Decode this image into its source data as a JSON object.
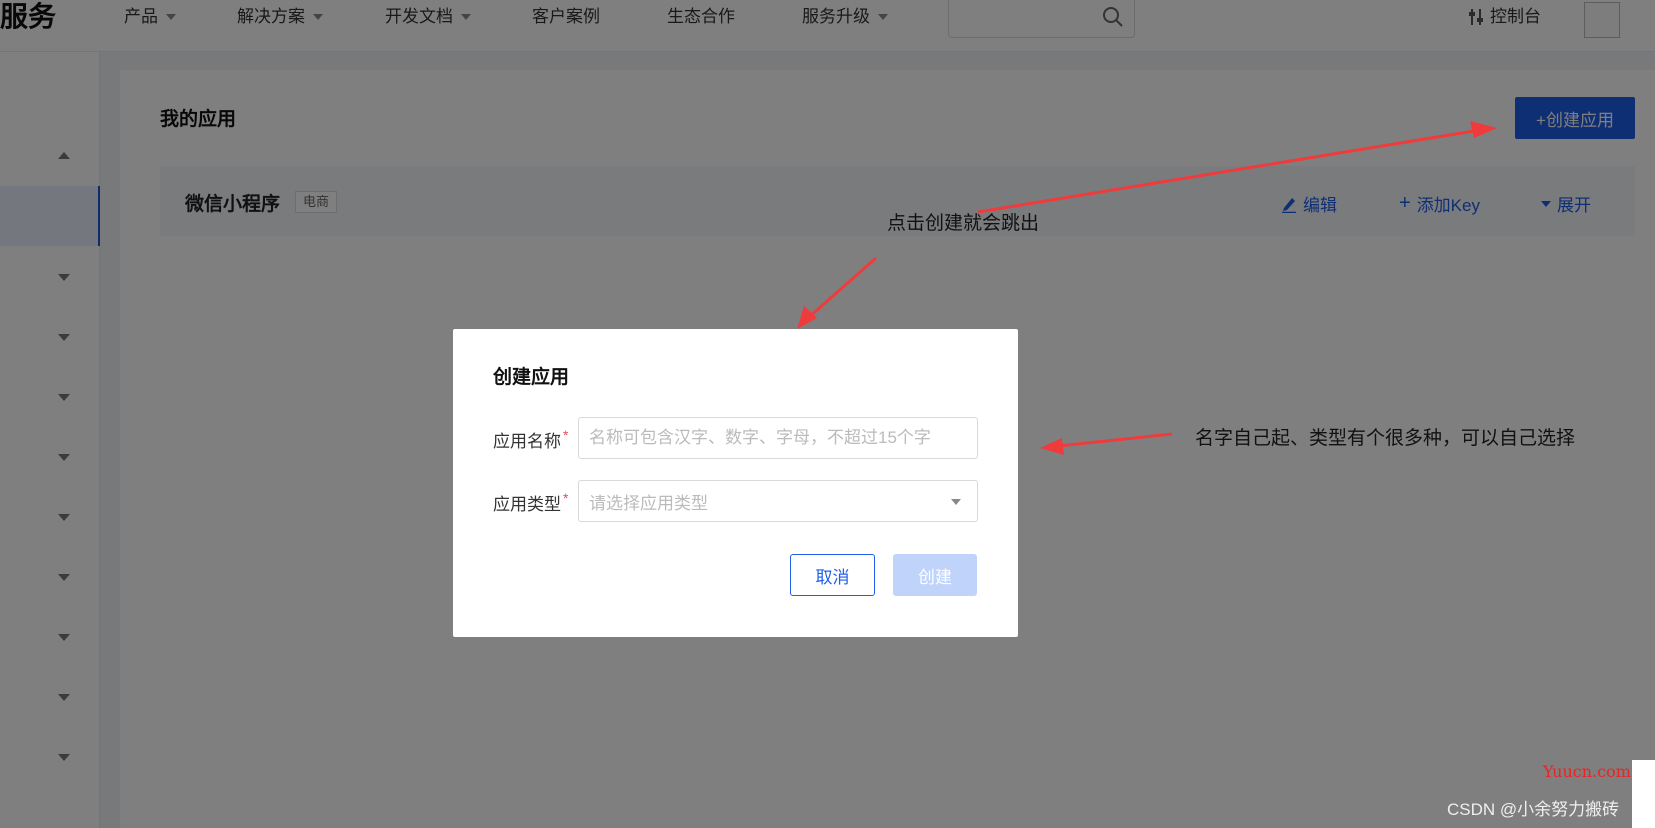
{
  "brand": "服务",
  "nav": {
    "items": [
      {
        "label": "产品",
        "has_dropdown": true
      },
      {
        "label": "解决方案",
        "has_dropdown": true
      },
      {
        "label": "开发文档",
        "has_dropdown": true
      },
      {
        "label": "客户案例",
        "has_dropdown": false
      },
      {
        "label": "生态合作",
        "has_dropdown": false
      },
      {
        "label": "服务升级",
        "has_dropdown": true
      }
    ],
    "search_placeholder": "",
    "console_label": "控制台"
  },
  "page": {
    "title": "我的应用",
    "create_button": "+创建应用"
  },
  "app_row": {
    "name": "微信小程序",
    "tag": "电商",
    "actions": {
      "edit": "编辑",
      "add_key": "添加Key",
      "expand": "展开"
    }
  },
  "dialog": {
    "title": "创建应用",
    "name_label": "应用名称",
    "name_placeholder": "名称可包含汉字、数字、字母，不超过15个字",
    "name_value": "",
    "type_label": "应用类型",
    "type_placeholder": "请选择应用类型",
    "required_mark": "*",
    "cancel_button": "取消",
    "create_button": "创建"
  },
  "annotations": {
    "note1": "点击创建就会跳出",
    "note2": "名字自己起、类型有个很多种，可以自己选择"
  },
  "watermarks": {
    "site": "Yuucn.com",
    "csdn": "CSDN @小余努力搬砖"
  },
  "colors": {
    "primary": "#1f5ee8",
    "arrow": "#ef3b3b",
    "required": "#e34d59"
  }
}
